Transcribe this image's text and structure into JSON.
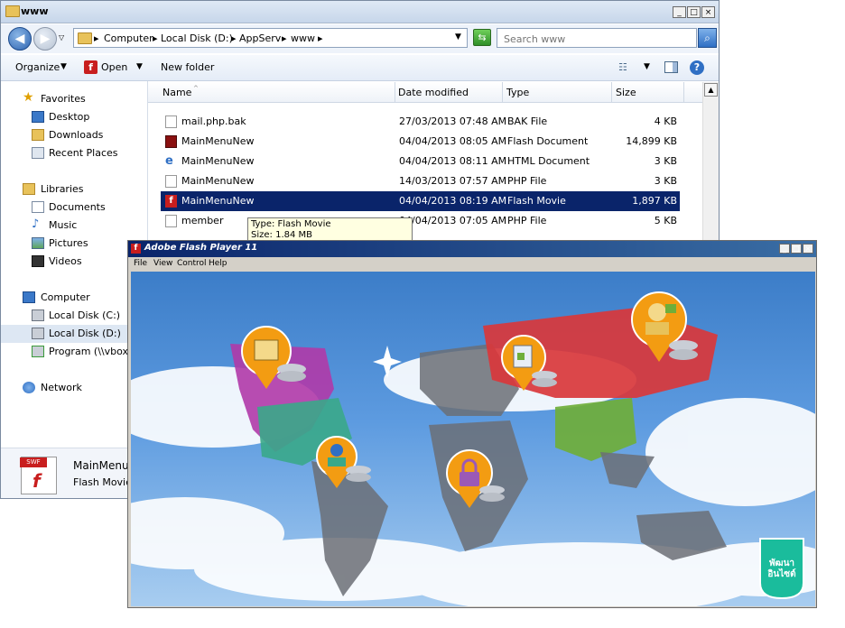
{
  "explorer": {
    "title": "www",
    "breadcrumb": [
      "Computer",
      "Local Disk (D:)",
      "AppServ",
      "www"
    ],
    "search_placeholder": "Search www",
    "toolbar": {
      "organize": "Organize",
      "open": "Open",
      "new_folder": "New folder"
    },
    "nav": {
      "favorites": "Favorites",
      "favorites_items": [
        "Desktop",
        "Downloads",
        "Recent Places"
      ],
      "libraries": "Libraries",
      "libraries_items": [
        "Documents",
        "Music",
        "Pictures",
        "Videos"
      ],
      "computer": "Computer",
      "computer_items": [
        "Local Disk (C:)",
        "Local Disk (D:)",
        "Program (\\\\vboxsr"
      ],
      "network": "Network"
    },
    "columns": {
      "name": "Name",
      "date": "Date modified",
      "type": "Type",
      "size": "Size"
    },
    "files": [
      {
        "name": "mail.php.bak",
        "date": "27/03/2013 07:48 AM",
        "type": "BAK File",
        "size": "4 KB"
      },
      {
        "name": "MainMenuNew",
        "date": "04/04/2013 08:05 AM",
        "type": "Flash Document",
        "size": "14,899 KB"
      },
      {
        "name": "MainMenuNew",
        "date": "04/04/2013 08:11 AM",
        "type": "HTML Document",
        "size": "3 KB"
      },
      {
        "name": "MainMenuNew",
        "date": "14/03/2013 07:57 AM",
        "type": "PHP File",
        "size": "3 KB"
      },
      {
        "name": "MainMenuNew",
        "date": "04/04/2013 08:19 AM",
        "type": "Flash Movie",
        "size": "1,897 KB"
      },
      {
        "name": "member",
        "date": "04/04/2013 07:05 AM",
        "type": "PHP File",
        "size": "5 KB"
      }
    ],
    "tooltip": {
      "type": "Type: Flash Movie",
      "size": "Size: 1.84 MB"
    },
    "details": {
      "name": "MainMenuN",
      "type": "Flash Movie",
      "badge": "SWF"
    }
  },
  "flash": {
    "title": "Adobe Flash Player 11",
    "menu": [
      "File",
      "View",
      "Control",
      "Help"
    ],
    "logo_text": [
      "พัฒนา",
      "อินไซต์"
    ]
  },
  "colors": {
    "selection": "#0a246a",
    "accent": "#f39c12",
    "sky": "#5d9be0"
  }
}
